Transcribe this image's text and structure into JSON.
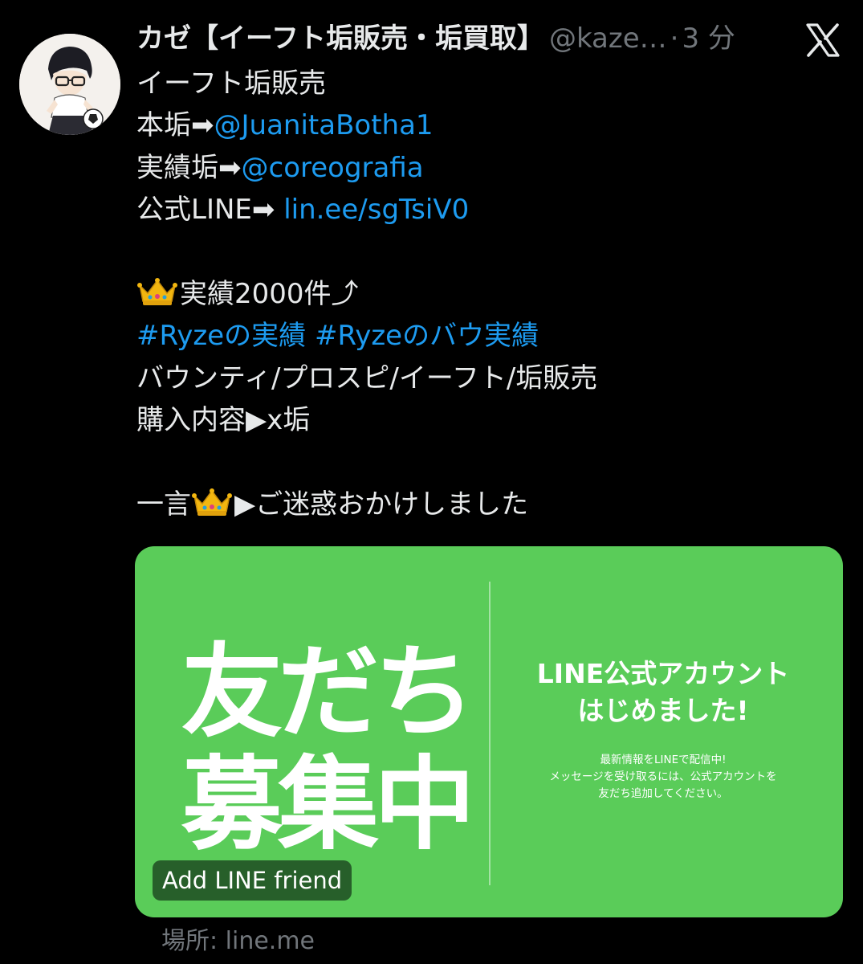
{
  "tweet": {
    "author": {
      "display_name": "カゼ【イーフト垢販売・垢買取】",
      "handle": "@kaze…",
      "separator": "·",
      "time": "3 分",
      "avatar_icon": "avatar-image"
    },
    "platform_icon": "x-logo-icon",
    "body": {
      "line1": "イーフト垢販売",
      "line2_prefix": "本垢➡",
      "line2_link": "@JuanitaBotha1",
      "line3_prefix": "実績垢➡",
      "line3_link": "@coreografia",
      "line4_prefix": "公式LINE➡ ",
      "line4_link": "lin.ee/sgTsiV0",
      "line6_text": "実績2000件⤴",
      "line7_hashtag1": "#Ryzeの実績",
      "line7_hashtag2": "#Ryzeのバウ実績",
      "line8": "バウンティ/プロスピ/イーフト/垢販売",
      "line9": "購入内容▶x垢",
      "line11_prefix": "一言",
      "line11_suffix": "▶ご迷惑おかけしました",
      "emoji": "crown-emoji"
    },
    "card": {
      "big_line1": "友だち",
      "big_line2": "募集中",
      "title_line1": "LINE公式アカウント",
      "title_line2": "はじめました!",
      "small_line1": "最新情報をLINEで配信中!",
      "small_line2": "メッセージを受け取るには、公式アカウントを",
      "small_line3": "友だち追加してください。",
      "button_label": "Add LINE friend",
      "domain": "場所: line.me",
      "background_color": "#5acc59",
      "button_color": "#275f2a"
    },
    "colors": {
      "background": "#000000",
      "text": "#e7e9ea",
      "secondary": "#71767b",
      "link": "#1d9bf0"
    }
  }
}
